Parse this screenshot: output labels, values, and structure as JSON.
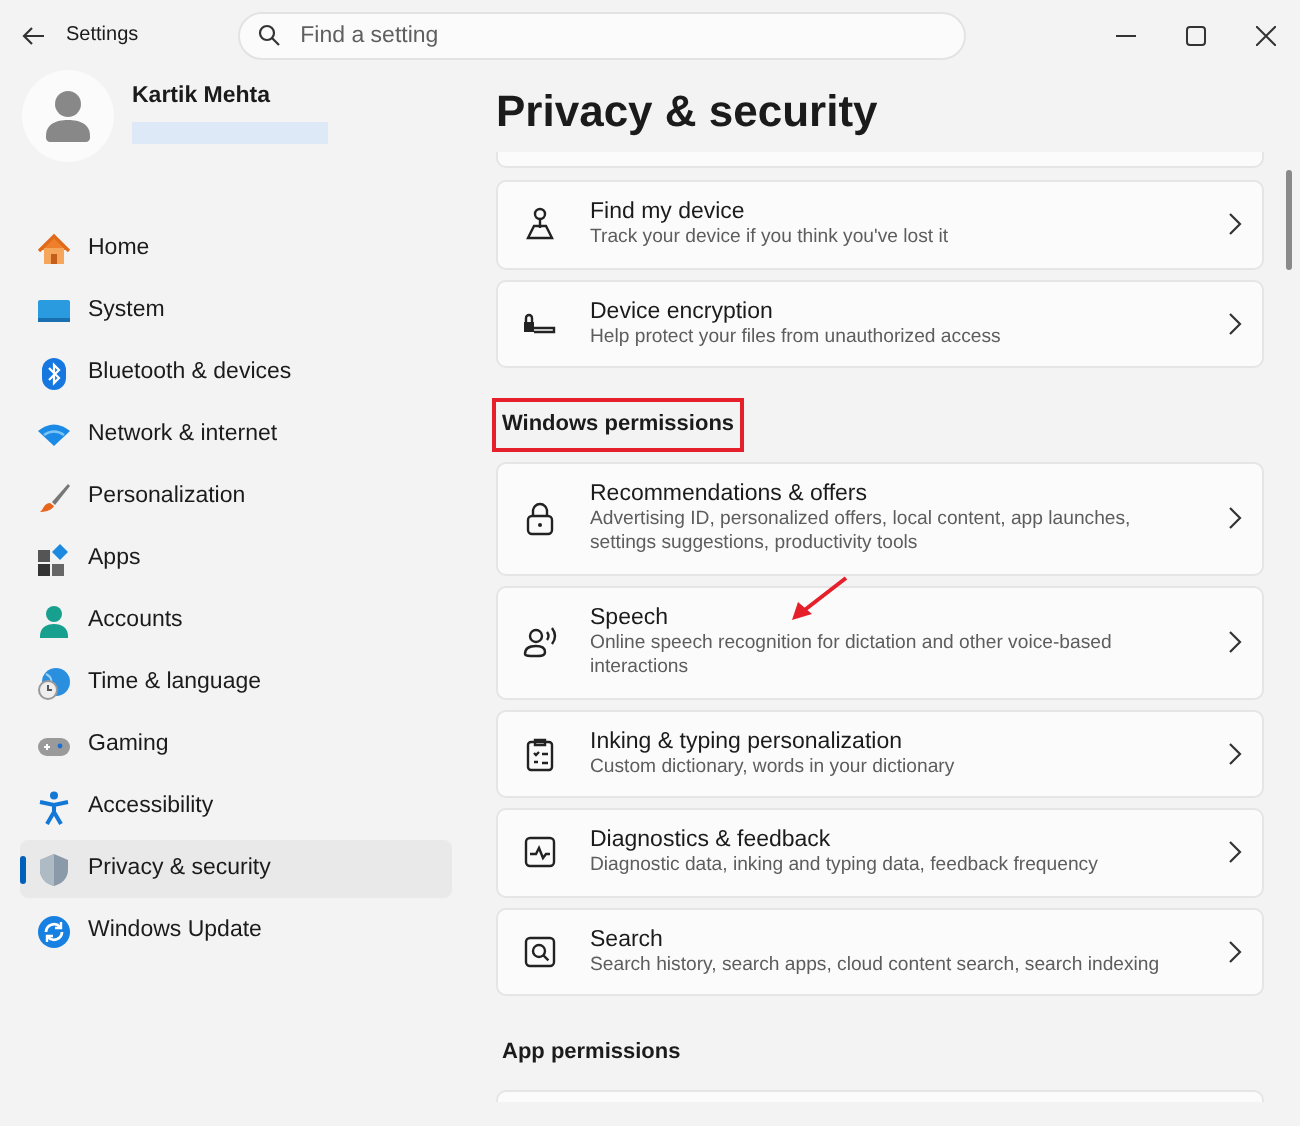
{
  "window": {
    "title": "Settings"
  },
  "search": {
    "placeholder": "Find a setting"
  },
  "profile": {
    "name": "Kartik Mehta"
  },
  "sidebar": {
    "items": [
      {
        "label": "Home",
        "selected": false
      },
      {
        "label": "System",
        "selected": false
      },
      {
        "label": "Bluetooth & devices",
        "selected": false
      },
      {
        "label": "Network & internet",
        "selected": false
      },
      {
        "label": "Personalization",
        "selected": false
      },
      {
        "label": "Apps",
        "selected": false
      },
      {
        "label": "Accounts",
        "selected": false
      },
      {
        "label": "Time & language",
        "selected": false
      },
      {
        "label": "Gaming",
        "selected": false
      },
      {
        "label": "Accessibility",
        "selected": false
      },
      {
        "label": "Privacy & security",
        "selected": true
      },
      {
        "label": "Windows Update",
        "selected": false
      }
    ]
  },
  "page_title": "Privacy & security",
  "sections": [
    {
      "items": [
        {
          "title": "Find my device",
          "description": "Track your device if you think you've lost it"
        },
        {
          "title": "Device encryption",
          "description": "Help protect your files from unauthorized access"
        }
      ]
    },
    {
      "heading": "Windows permissions",
      "highlighted": true,
      "items": [
        {
          "title": "Recommendations & offers",
          "description": "Advertising ID, personalized offers, local content, app launches, settings suggestions, productivity tools"
        },
        {
          "title": "Speech",
          "description": "Online speech recognition for dictation and other voice-based interactions",
          "pointed_at": true
        },
        {
          "title": "Inking & typing personalization",
          "description": "Custom dictionary, words in your dictionary"
        },
        {
          "title": "Diagnostics & feedback",
          "description": "Diagnostic data, inking and typing data, feedback frequency"
        },
        {
          "title": "Search",
          "description": "Search history, search apps, cloud content search, search indexing"
        }
      ]
    },
    {
      "heading": "App permissions",
      "highlighted": false
    }
  ]
}
